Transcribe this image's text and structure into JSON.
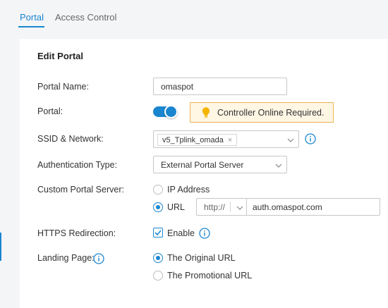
{
  "tabs": [
    {
      "label": "Portal",
      "active": true
    },
    {
      "label": "Access Control",
      "active": false
    }
  ],
  "form": {
    "heading": "Edit Portal",
    "portal_name": {
      "label": "Portal Name:",
      "value": "omaspot"
    },
    "portal": {
      "label": "Portal:",
      "enabled": true,
      "notice": "Controller Online Required."
    },
    "ssid": {
      "label": "SSID & Network:",
      "tags": [
        "v5_Tplink_omada"
      ]
    },
    "auth_type": {
      "label": "Authentication Type:",
      "value": "External Portal Server"
    },
    "custom_server": {
      "label": "Custom Portal Server:",
      "options": [
        "IP Address",
        "URL"
      ],
      "selected": "URL",
      "protocol": "http://",
      "url": "auth.omaspot.com"
    },
    "https_redirection": {
      "label": "HTTPS Redirection:",
      "checkbox_label": "Enable",
      "checked": true
    },
    "landing_page": {
      "label": "Landing Page:",
      "options": [
        "The Original URL",
        "The Promotional URL"
      ],
      "selected": "The Original URL"
    }
  },
  "colors": {
    "accent": "#1a86d0",
    "notice_bg": "#fff6e4",
    "notice_border": "#f0b454",
    "bulb": "#f5b400"
  },
  "icons": [
    "lightbulb-icon",
    "info-icon",
    "chevron-down-icon",
    "close-icon",
    "check-icon"
  ]
}
